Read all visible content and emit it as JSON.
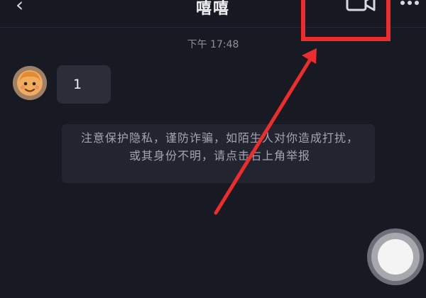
{
  "header": {
    "back_icon": "chevron-left-icon",
    "title": "嘻嘻",
    "video_call_icon": "video-camera-icon",
    "more_icon": "more-horizontal-icon"
  },
  "conversation": {
    "timestamp": "下午 17:48",
    "messages": [
      {
        "avatar_icon": "cartoon-avatar-icon",
        "text": "1"
      }
    ],
    "system_notice": "注意保护隐私，谨防诈骗，如陌生人对你造成打扰，或其身份不明，请点击右上角举报"
  },
  "annotation": {
    "highlight_color": "#ee2c2c",
    "arrow_color": "#ee2c2c"
  },
  "floating_action": {
    "icon": "circle-record-icon"
  }
}
